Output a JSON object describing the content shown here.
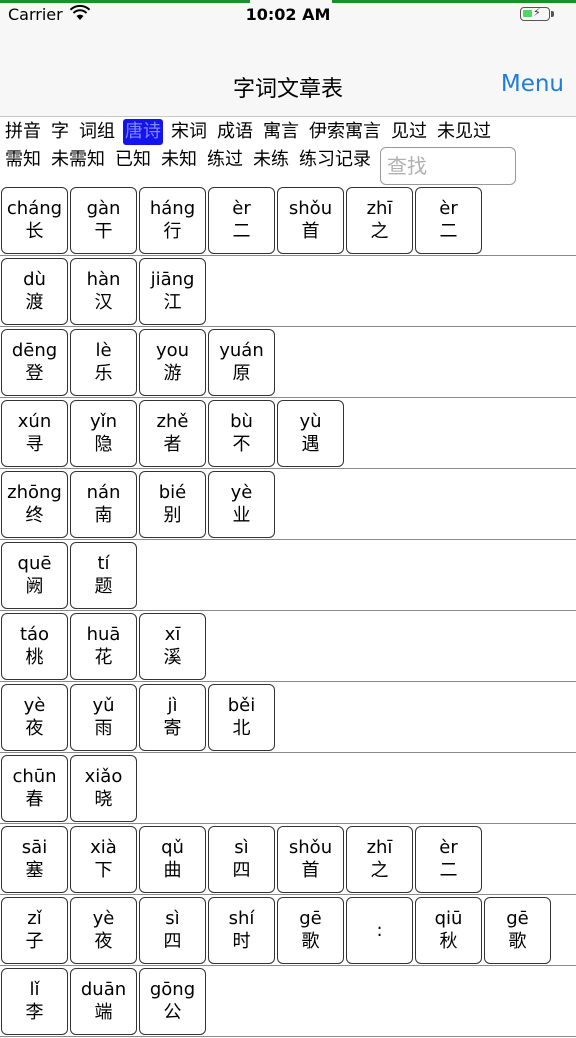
{
  "status": {
    "carrier": "Carrier",
    "time": "10:02 AM"
  },
  "nav": {
    "title": "字词文章表",
    "menu": "Menu"
  },
  "filters_row1": [
    {
      "label": "拼音",
      "selected": false
    },
    {
      "label": "字",
      "selected": false
    },
    {
      "label": "词组",
      "selected": false
    },
    {
      "label": "唐诗",
      "selected": true
    },
    {
      "label": "宋词",
      "selected": false
    },
    {
      "label": "成语",
      "selected": false
    },
    {
      "label": "寓言",
      "selected": false
    },
    {
      "label": "伊索寓言",
      "selected": false
    },
    {
      "label": "见过",
      "selected": false
    },
    {
      "label": "未见过",
      "selected": false
    }
  ],
  "filters_row2": [
    {
      "label": "需知",
      "selected": false
    },
    {
      "label": "未需知",
      "selected": false
    },
    {
      "label": "已知",
      "selected": false
    },
    {
      "label": "未知",
      "selected": false
    },
    {
      "label": "练过",
      "selected": false
    },
    {
      "label": "未练",
      "selected": false
    },
    {
      "label": "练习记录",
      "selected": false
    }
  ],
  "search": {
    "placeholder": "查找",
    "value": ""
  },
  "rows": [
    [
      [
        "cháng",
        "长"
      ],
      [
        "gàn",
        "干"
      ],
      [
        "háng",
        "行"
      ],
      [
        "èr",
        "二"
      ],
      [
        "shǒu",
        "首"
      ],
      [
        "zhī",
        "之"
      ],
      [
        "èr",
        "二"
      ]
    ],
    [
      [
        "dù",
        "渡"
      ],
      [
        "hàn",
        "汉"
      ],
      [
        "jiāng",
        "江"
      ]
    ],
    [
      [
        "dēng",
        "登"
      ],
      [
        "lè",
        "乐"
      ],
      [
        "you",
        "游"
      ],
      [
        "yuán",
        "原"
      ]
    ],
    [
      [
        "xún",
        "寻"
      ],
      [
        "yǐn",
        "隐"
      ],
      [
        "zhě",
        "者"
      ],
      [
        "bù",
        "不"
      ],
      [
        "yù",
        "遇"
      ]
    ],
    [
      [
        "zhōng",
        "终"
      ],
      [
        "nán",
        "南"
      ],
      [
        "bié",
        "别"
      ],
      [
        "yè",
        "业"
      ]
    ],
    [
      [
        "quē",
        "阙"
      ],
      [
        "tí",
        "题"
      ]
    ],
    [
      [
        "táo",
        "桃"
      ],
      [
        "huā",
        "花"
      ],
      [
        "xī",
        "溪"
      ]
    ],
    [
      [
        "yè",
        "夜"
      ],
      [
        "yǔ",
        "雨"
      ],
      [
        "jì",
        "寄"
      ],
      [
        "běi",
        "北"
      ]
    ],
    [
      [
        "chūn",
        "春"
      ],
      [
        "xiǎo",
        "晓"
      ]
    ],
    [
      [
        "sāi",
        "塞"
      ],
      [
        "xià",
        "下"
      ],
      [
        "qǔ",
        "曲"
      ],
      [
        "sì",
        "四"
      ],
      [
        "shǒu",
        "首"
      ],
      [
        "zhī",
        "之"
      ],
      [
        "èr",
        "二"
      ]
    ],
    [
      [
        "zǐ",
        "子"
      ],
      [
        "yè",
        "夜"
      ],
      [
        "sì",
        "四"
      ],
      [
        "shí",
        "时"
      ],
      [
        "gē",
        "歌"
      ],
      [
        "",
        ":"
      ],
      [
        "qiū",
        "秋"
      ],
      [
        "gē",
        "歌"
      ]
    ],
    [
      [
        "lǐ",
        "李"
      ],
      [
        "duān",
        "端"
      ],
      [
        "gōng",
        "公"
      ]
    ]
  ]
}
